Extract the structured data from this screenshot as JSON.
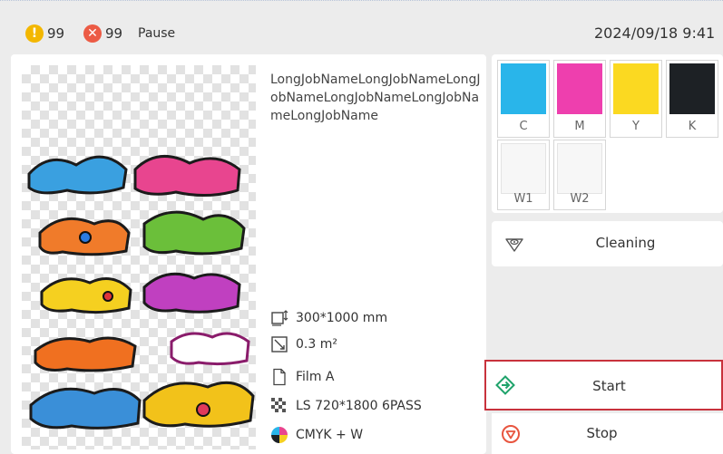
{
  "status_bar": {
    "warning_count": "99",
    "error_count": "99",
    "status": "Pause",
    "datetime": "2024/09/18 9:41"
  },
  "job": {
    "name": "LongJobNameLongJobNameLongJobNameLongJobNameLongJobNameLongJobName",
    "size": "300*1000 mm",
    "area": "0.3 m²",
    "media": "Film A",
    "mode": "LS 720*1800 6PASS",
    "ink_config": "CMYK + W"
  },
  "inks": [
    {
      "label": "C",
      "color": "#29b5ea"
    },
    {
      "label": "M",
      "color": "#ee3fae"
    },
    {
      "label": "Y",
      "color": "#fbd921"
    },
    {
      "label": "K",
      "color": "#1d2125"
    },
    {
      "label": "W1",
      "color": "#f7f7f7"
    },
    {
      "label": "W2",
      "color": "#f7f7f7"
    }
  ],
  "actions": {
    "cleaning": "Cleaning",
    "start": "Start",
    "stop": "Stop"
  },
  "colors": {
    "warning": "#f3b700",
    "error": "#ec5b45",
    "start_green": "#1fa36b",
    "stop_red": "#e8553f",
    "highlight_border": "#c8323c"
  }
}
